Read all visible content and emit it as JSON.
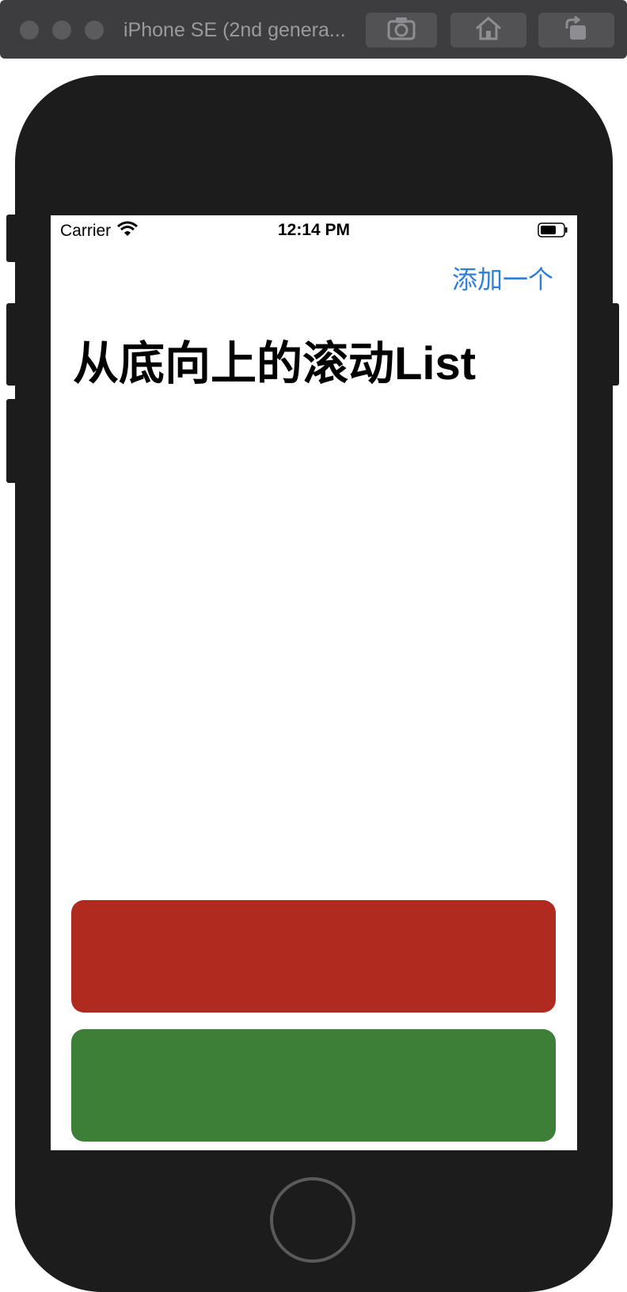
{
  "window": {
    "title": "iPhone SE (2nd genera...",
    "toolbar": {
      "screenshot_icon": "camera-icon",
      "home_icon": "home-icon",
      "rotate_icon": "rotate-icon"
    }
  },
  "status_bar": {
    "carrier": "Carrier",
    "time": "12:14 PM"
  },
  "nav": {
    "add_button_label": "添加一个",
    "title": "从底向上的滚动List"
  },
  "list": {
    "items": [
      {
        "color": "#b02a20"
      },
      {
        "color": "#3d7f37"
      }
    ]
  },
  "colors": {
    "accent": "#2f7fd8",
    "device_body": "#1c1c1c",
    "titlebar": "#3d3d3f"
  }
}
